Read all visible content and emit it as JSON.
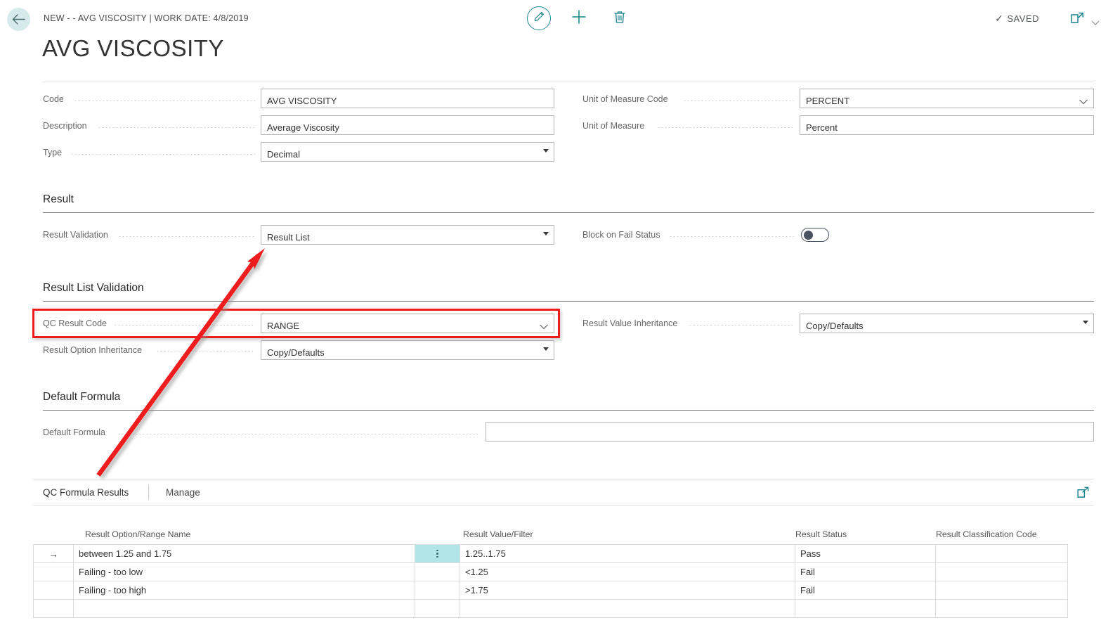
{
  "header": {
    "back_icon": "back-arrow-icon",
    "breadcrumb": "NEW - - AVG VISCOSITY | WORK DATE: 4/8/2019",
    "edit_icon": "pencil-edit-icon",
    "new_icon": "plus-icon",
    "delete_icon": "trash-icon",
    "saved_label": "SAVED",
    "saved_check": "✓",
    "popout_icon": "open-in-new-window-icon",
    "chevron_icon": "chevron-down-icon"
  },
  "title": "AVG VISCOSITY",
  "general": {
    "fields": [
      {
        "label": "Code",
        "value": "AVG VISCOSITY",
        "control": "text"
      },
      {
        "label": "Description",
        "value": "Average Viscosity",
        "control": "text"
      },
      {
        "label": "Type",
        "value": "Decimal",
        "control": "dropdown"
      }
    ],
    "right_fields": [
      {
        "label": "Unit of Measure Code",
        "value": "PERCENT",
        "control": "lookup"
      },
      {
        "label": "Unit of Measure",
        "value": "Percent",
        "control": "text"
      }
    ]
  },
  "result_section": {
    "heading": "Result",
    "result_validation": {
      "label": "Result Validation",
      "value": "Result List",
      "control": "dropdown"
    },
    "block_on_fail": {
      "label": "Block on Fail Status",
      "value": "off",
      "control": "toggle"
    }
  },
  "result_list_validation": {
    "heading": "Result List Validation",
    "qc_result_code": {
      "label": "QC Result Code",
      "value": "RANGE",
      "control": "lookup"
    },
    "result_option_inheritance": {
      "label": "Result Option Inheritance",
      "value": "Copy/Defaults",
      "control": "dropdown"
    },
    "result_value_inheritance": {
      "label": "Result Value Inheritance",
      "value": "Copy/Defaults",
      "control": "dropdown"
    }
  },
  "default_formula_section": {
    "heading": "Default Formula",
    "default_formula": {
      "label": "Default Formula",
      "value": "",
      "control": "text"
    }
  },
  "subpage": {
    "title": "QC Formula Results",
    "manage_tab": "Manage",
    "expand_icon": "expand-subpage-icon"
  },
  "table": {
    "columns": [
      "Result Option/Range Name",
      "Result Value/Filter",
      "Result Status",
      "Result Classification Code"
    ],
    "rows": [
      {
        "selected": true,
        "row_indicator": "→",
        "menu_icon": "kebab-menu-icon",
        "range_name": "between 1.25 and 1.75",
        "value_filter": "1.25..1.75",
        "status": "Pass",
        "classification": ""
      },
      {
        "selected": false,
        "row_indicator": "",
        "menu_icon": "",
        "range_name": "Failing - too low",
        "value_filter": "<1.25",
        "status": "Fail",
        "classification": ""
      },
      {
        "selected": false,
        "row_indicator": "",
        "menu_icon": "",
        "range_name": "Failing - too high",
        "value_filter": ">1.75",
        "status": "Fail",
        "classification": ""
      },
      {
        "selected": false,
        "row_indicator": "",
        "menu_icon": "",
        "range_name": "",
        "value_filter": "",
        "status": "",
        "classification": ""
      }
    ]
  },
  "annotation": {
    "highlight_color": "#ee1b1b",
    "arrow_color": "#ee1b1b",
    "highlighted_field": "QC Result Code",
    "arrow_points_to": "Result Validation"
  },
  "colors": {
    "accent_teal": "#18828c",
    "back_circle": "#d6eaec",
    "selected_cell": "#b2e5e8"
  }
}
